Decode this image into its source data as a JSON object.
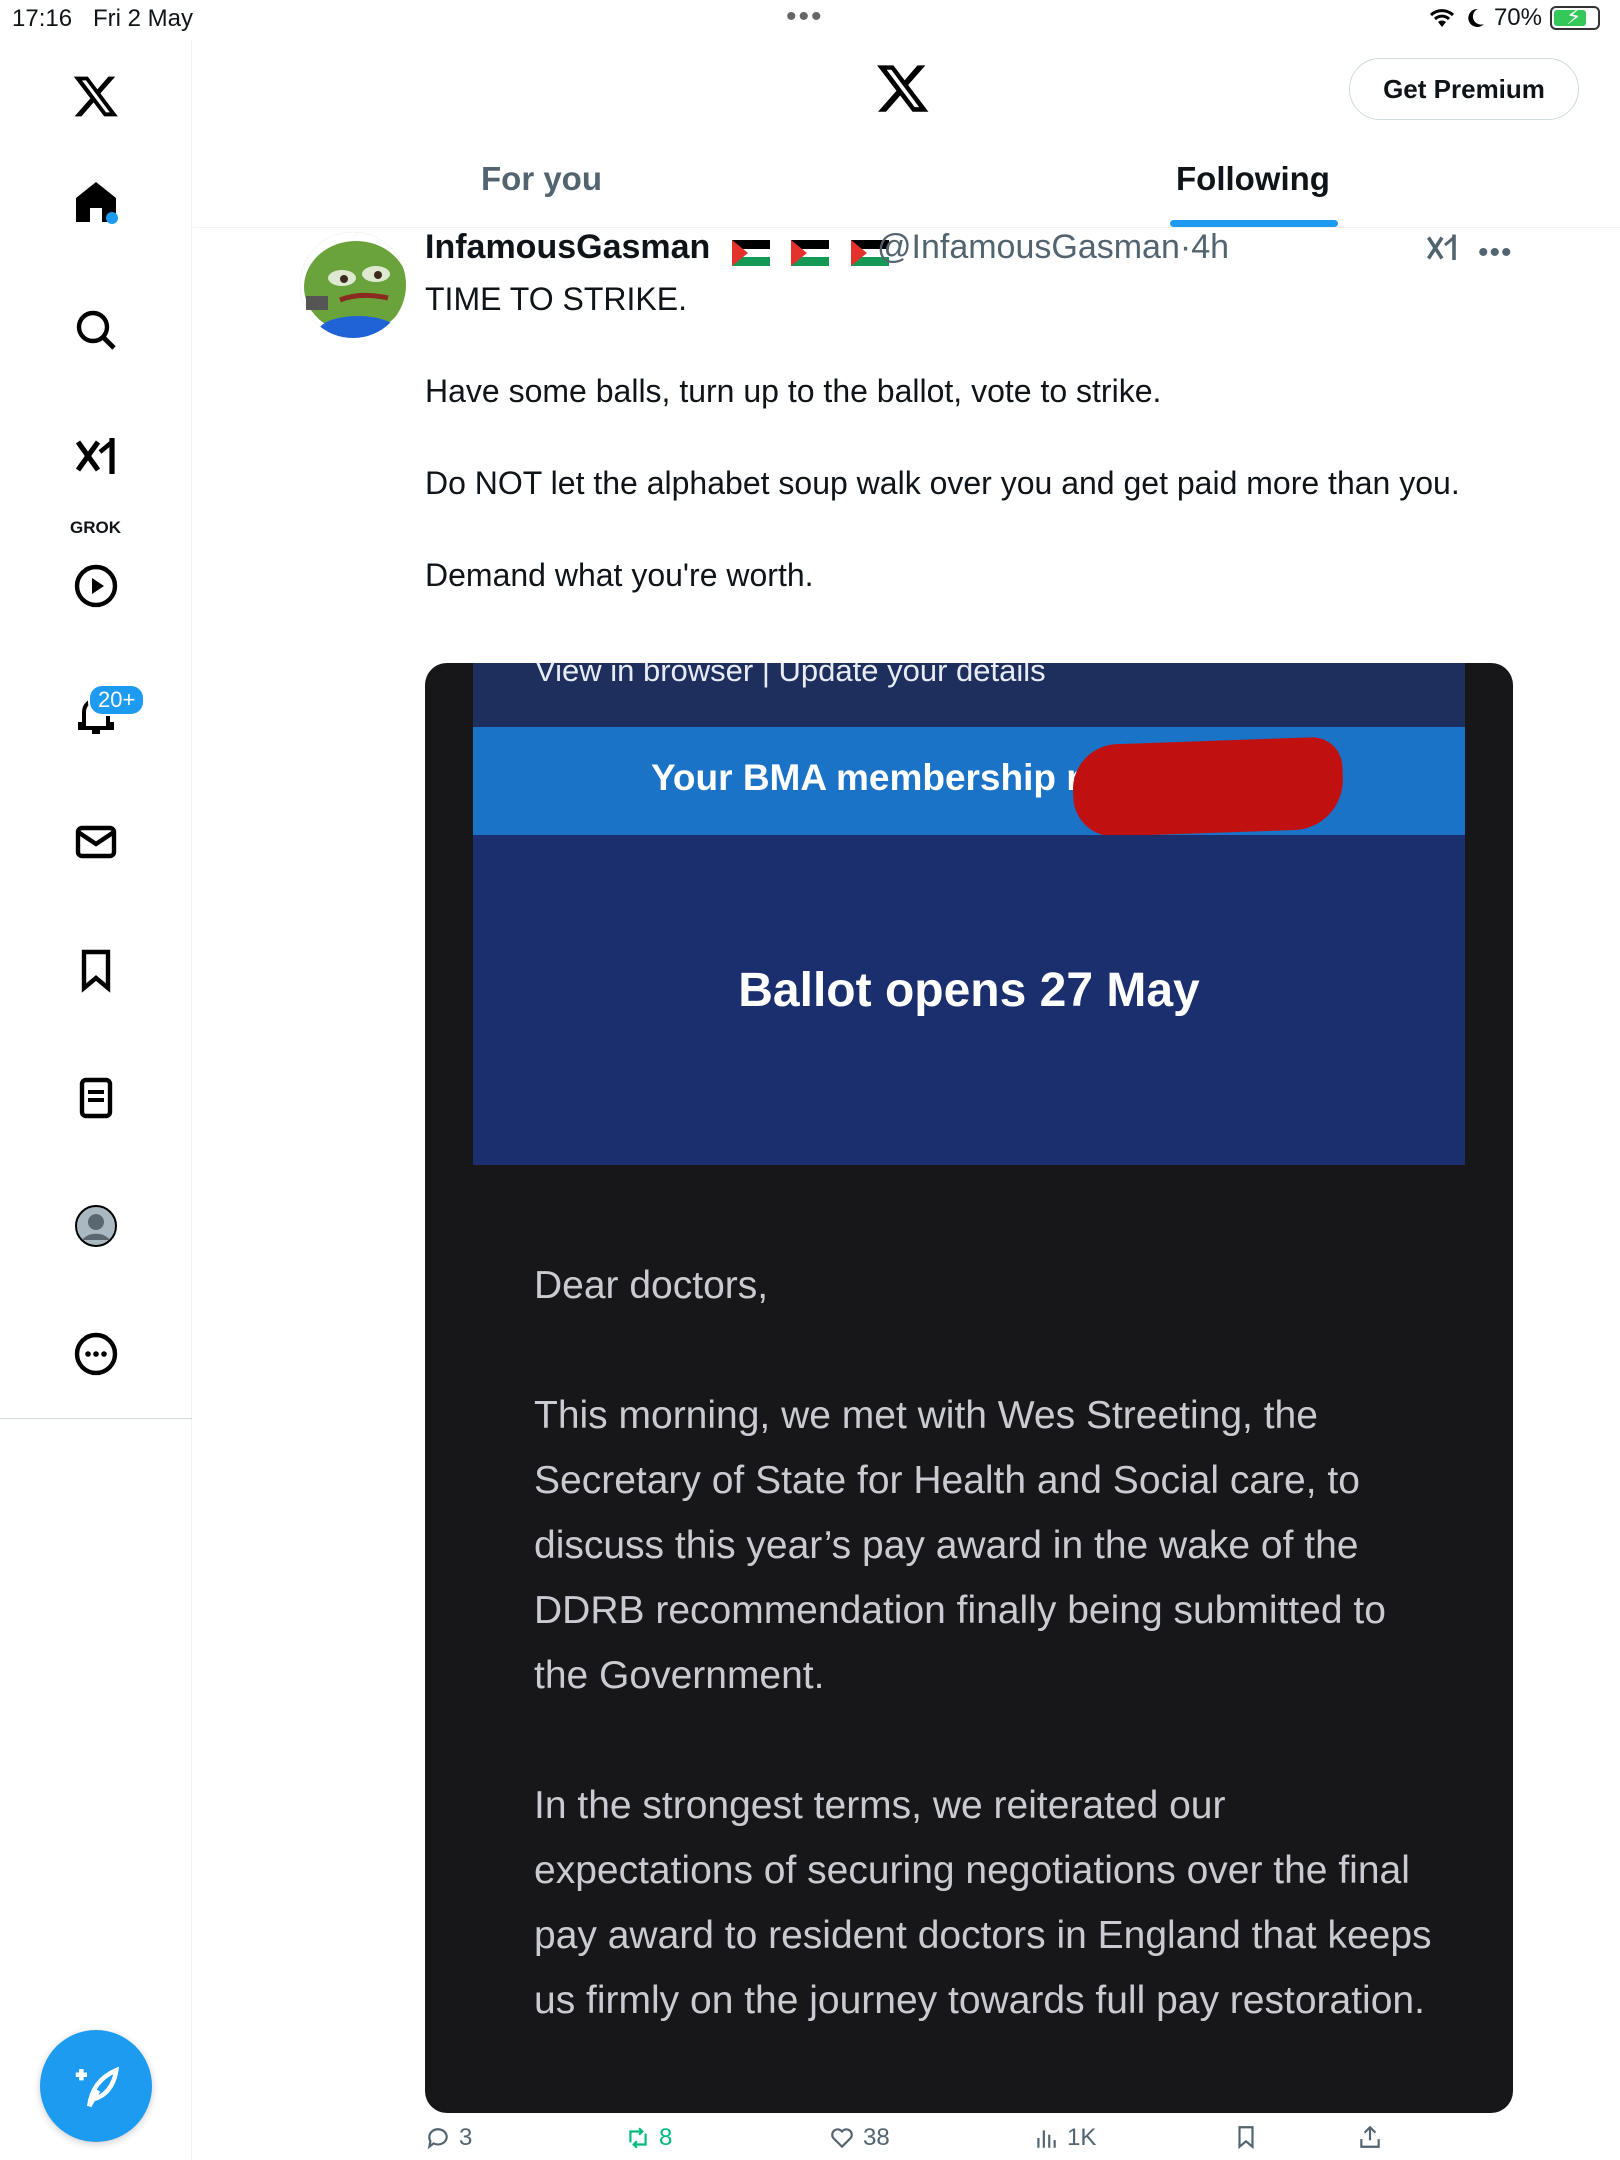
{
  "status_bar": {
    "time": "17:16",
    "date": "Fri 2 May",
    "battery": "70%",
    "battery_level": 0.7
  },
  "sidebar": {
    "grok_label": "GROK",
    "notifications_badge": "20+"
  },
  "header": {
    "premium_label": "Get Premium",
    "tabs": [
      {
        "label": "For you",
        "selected": false
      },
      {
        "label": "Following",
        "selected": true
      }
    ]
  },
  "tweet": {
    "author_name": "InfamousGasman",
    "handle": "@InfamousGasman",
    "time": "4h",
    "separator": "·",
    "text": [
      "TIME TO STRIKE.",
      "Have some balls, turn up to the ballot, vote to strike.",
      "Do NOT let the alphabet soup walk over you and get paid more than you.",
      "Demand what you're worth."
    ],
    "media": {
      "top_links": "View in browser  |  Update your details",
      "banner": "Your BMA membership n",
      "headline": "Ballot opens 27 May",
      "body": [
        "Dear doctors,",
        "This morning, we met with Wes Streeting, the Secretary of State for Health and Social care, to discuss this year’s pay award in the wake of the DDRB recommendation finally being submitted to the Government.",
        "In the strongest terms, we reiterated our expectations of securing negotiations over the final pay award to resident doctors in England that keeps us firmly on the journey towards full pay restoration."
      ]
    },
    "actions": {
      "replies": "3",
      "reposts": "8",
      "likes": "38",
      "views": "1K"
    }
  },
  "colors": {
    "accent": "#1d9bf0",
    "repost_active": "#00ba7c",
    "text": "#0f1419",
    "muted": "#536471"
  }
}
